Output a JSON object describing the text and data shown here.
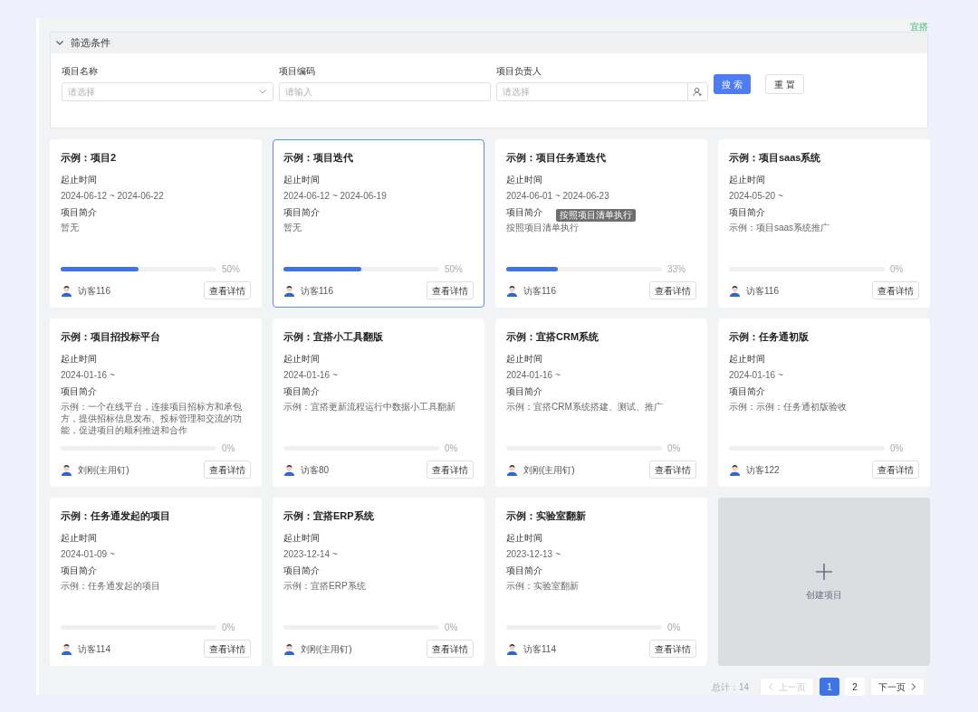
{
  "corner_label": "宜搭",
  "filter": {
    "title": "筛选条件",
    "expanded": true,
    "fields": [
      {
        "kind": "select",
        "label": "项目名称",
        "placeholder": "请选择"
      },
      {
        "kind": "input",
        "label": "项目编码",
        "placeholder": "请输入"
      },
      {
        "kind": "person",
        "label": "项目负责人",
        "placeholder": "请选择"
      }
    ],
    "buttons": [
      {
        "label": "搜 索",
        "primary": true
      },
      {
        "label": "重 置",
        "primary": false
      }
    ]
  },
  "projects": [
    {
      "title": "示例：项目2",
      "date_label": "起止时间",
      "dates": "2024-06-12 ~ 2024-06-22",
      "desc_label": "项目简介",
      "desc": "暂无",
      "level": 0.5,
      "percent": "50%",
      "owner": "访客116",
      "action": "查看详情",
      "selected": false
    },
    {
      "title": "示例：项目迭代",
      "date_label": "起止时间",
      "dates": "2024-06-12 ~ 2024-06-19",
      "desc_label": "项目简介",
      "desc": "暂无",
      "level": 0.5,
      "percent": "50%",
      "owner": "访客116",
      "action": "查看详情",
      "selected": true
    },
    {
      "title": "示例：项目任务通迭代",
      "date_label": "起止时间",
      "dates": "2024-06-01 ~ 2024-06-23",
      "desc_label": "项目简介",
      "desc": "按照项目清单执行",
      "tooltip": "按照项目清单执行",
      "level": 0.33,
      "percent": "33%",
      "owner": "访客116",
      "action": "查看详情",
      "selected": false
    },
    {
      "title": "示例：项目saas系统",
      "date_label": "起止时间",
      "dates": "2024-05-20 ~",
      "desc_label": "项目简介",
      "desc": "示例：项目saas系统推广",
      "level": 0,
      "percent": "0%",
      "owner": "访客116",
      "action": "查看详情",
      "selected": false
    },
    {
      "title": "示例：项目招投标平台",
      "date_label": "起止时间",
      "dates": "2024-01-16 ~",
      "desc_label": "项目简介",
      "desc": "示例：一个在线平台，连接项目招标方和承包方，提供招标信息发布、投标管理和交流的功能，促进项目的顺利推进和合作",
      "level": 0,
      "percent": "0%",
      "owner": "刘刚(主用钉)",
      "action": "查看详情",
      "selected": false
    },
    {
      "title": "示例：宜搭小工具翻版",
      "date_label": "起止时间",
      "dates": "2024-01-16 ~",
      "desc_label": "项目简介",
      "desc": "示例：宜搭更新流程运行中数据小工具翻新",
      "level": 0,
      "percent": "0%",
      "owner": "访客80",
      "action": "查看详情",
      "selected": false
    },
    {
      "title": "示例：宜搭CRM系统",
      "date_label": "起止时间",
      "dates": "2024-01-16 ~",
      "desc_label": "项目简介",
      "desc": "示例：宜搭CRM系统搭建、测试、推广",
      "level": 0,
      "percent": "0%",
      "owner": "刘刚(主用钉)",
      "action": "查看详情",
      "selected": false
    },
    {
      "title": "示例：任务通初版",
      "date_label": "起止时间",
      "dates": "2024-01-16 ~",
      "desc_label": "项目简介",
      "desc": "示例：示例：任务通初版验收",
      "level": 0,
      "percent": "0%",
      "owner": "访客122",
      "action": "查看详情",
      "selected": false
    },
    {
      "title": "示例：任务通发起的项目",
      "date_label": "起止时间",
      "dates": "2024-01-09 ~",
      "desc_label": "项目简介",
      "desc": "示例：任务通发起的项目",
      "level": 0,
      "percent": "0%",
      "owner": "访客114",
      "action": "查看详情",
      "selected": false
    },
    {
      "title": "示例：宜搭ERP系统",
      "date_label": "起止时间",
      "dates": "2023-12-14 ~",
      "desc_label": "项目简介",
      "desc": "示例：宜搭ERP系统",
      "level": 0,
      "percent": "0%",
      "owner": "刘刚(主用钉)",
      "action": "查看详情",
      "selected": false
    },
    {
      "title": "示例：实验室翻新",
      "date_label": "起止时间",
      "dates": "2023-12-13 ~",
      "desc_label": "项目简介",
      "desc": "示例：实验室翻新",
      "level": 0,
      "percent": "0%",
      "owner": "访客114",
      "action": "查看详情",
      "selected": false
    }
  ],
  "create": {
    "label": "创建项目"
  },
  "pagination": {
    "total": "总计：14",
    "prev": {
      "label": "上一页",
      "disabled": true
    },
    "pages": [
      {
        "label": "1",
        "selected": true
      },
      {
        "label": "2",
        "selected": false
      }
    ],
    "next": {
      "label": "下一页",
      "disabled": false
    }
  }
}
